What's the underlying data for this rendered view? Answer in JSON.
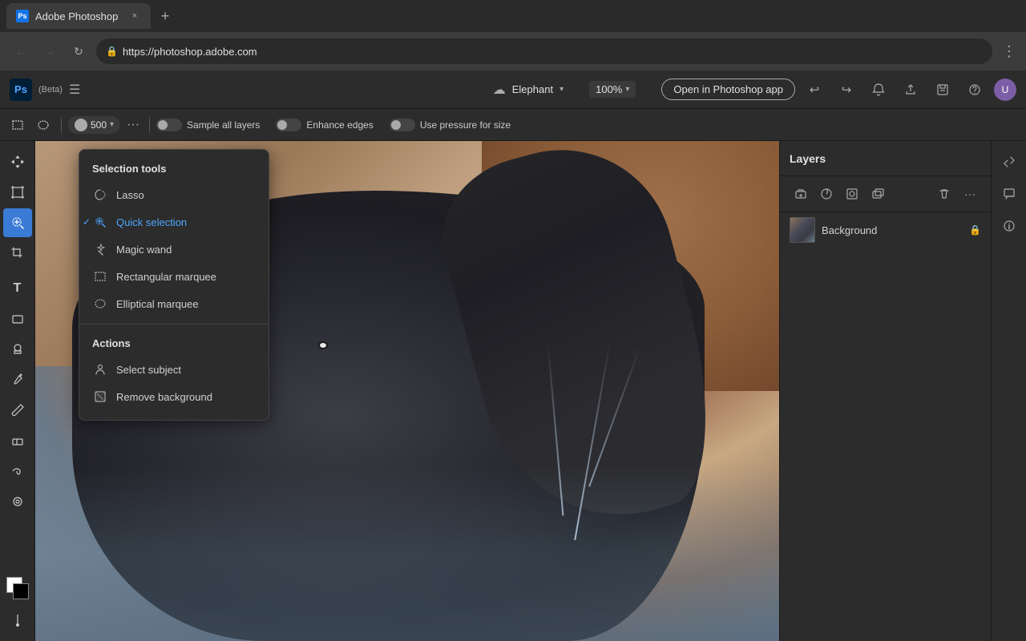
{
  "browser": {
    "tab": {
      "favicon_text": "Ps",
      "title": "Adobe Photoshop",
      "close_label": "×",
      "new_tab_label": "+"
    },
    "address": {
      "url": "https://photoshop.adobe.com",
      "lock_icon": "🔒",
      "menu_icon": "⋮"
    },
    "nav": {
      "back": "←",
      "forward": "→",
      "reload": "↻"
    }
  },
  "app": {
    "header": {
      "logo_text": "Ps",
      "beta_label": "(Beta)",
      "hamburger_icon": "☰",
      "cloud_icon": "☁",
      "doc_name": "Elephant",
      "zoom_level": "100%",
      "open_btn_label": "Open in Photoshop app",
      "undo_icon": "↩",
      "redo_icon": "↪",
      "notification_icon": "🔔",
      "share_icon": "⬆",
      "save_icon": "💾",
      "help_icon": "?",
      "avatar_text": "U"
    },
    "toolbar": {
      "marquee_rect_icon": "⬚",
      "marquee_circle_icon": "◯",
      "brush_size": "500",
      "more_icon": "···",
      "sample_all_layers": "Sample all layers",
      "enhance_edges": "Enhance edges",
      "use_pressure": "Use pressure for size"
    },
    "left_tools": {
      "move_icon": "✛",
      "artboard_icon": "⊞",
      "selection_icon": "⊡",
      "lasso_icon": "⌾",
      "crop_icon": "⌗",
      "type_icon": "T",
      "shape_icon": "⬟",
      "stamp_icon": "⊕",
      "eyedropper_icon": "⊘",
      "brush_icon": "✏",
      "eraser_icon": "◻",
      "smudge_icon": "〜",
      "dodge_icon": "○",
      "pen_icon": "✒",
      "adjust_icon": "⊻"
    },
    "layers_panel": {
      "title": "Layers",
      "add_icon": "+",
      "effects_icon": "◑",
      "mask_icon": "◻",
      "clip_icon": "⊞",
      "delete_icon": "🗑",
      "more_icon": "···",
      "layers": [
        {
          "name": "Background",
          "lock": true
        }
      ]
    },
    "selection_menu": {
      "section_title": "Selection tools",
      "items": [
        {
          "label": "Lasso",
          "icon": "⌾",
          "checked": false
        },
        {
          "label": "Quick selection",
          "icon": "⊡",
          "checked": true
        },
        {
          "label": "Magic wand",
          "icon": "✦",
          "checked": false
        },
        {
          "label": "Rectangular marquee",
          "icon": "⬚",
          "checked": false
        },
        {
          "label": "Elliptical marquee",
          "icon": "◯",
          "checked": false
        }
      ],
      "actions_title": "Actions",
      "actions": [
        {
          "label": "Select subject",
          "icon": "👤"
        },
        {
          "label": "Remove background",
          "icon": "🖼"
        }
      ]
    }
  }
}
